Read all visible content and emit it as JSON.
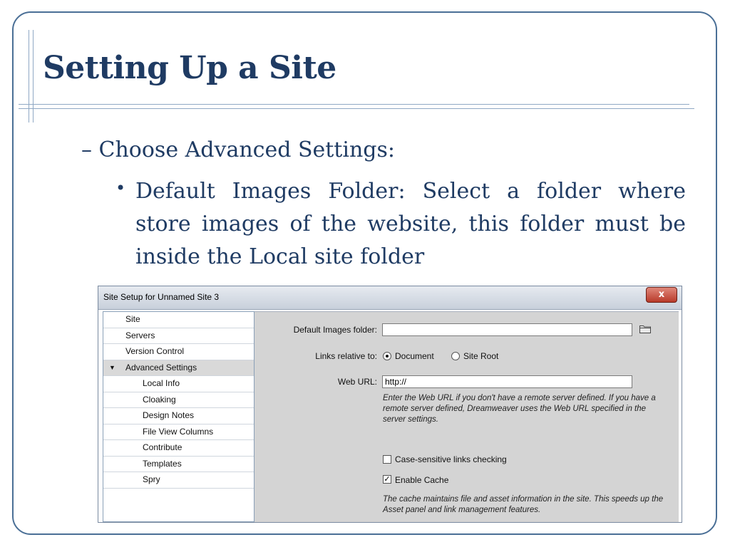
{
  "slide": {
    "title": "Setting Up a Site",
    "level1": "– Choose Advanced Settings:",
    "bullet": "•",
    "level2": "Default Images Folder: Select a folder where store images of the website, this folder must be inside the Local site folder"
  },
  "dialog": {
    "title": "Site Setup for Unnamed Site 3",
    "close_label": "x",
    "nav": [
      {
        "label": "Site"
      },
      {
        "label": "Servers"
      },
      {
        "label": "Version Control"
      },
      {
        "label": "Advanced Settings",
        "expanded": true
      },
      {
        "label": "Local Info"
      },
      {
        "label": "Cloaking"
      },
      {
        "label": "Design Notes"
      },
      {
        "label": "File View Columns"
      },
      {
        "label": "Contribute"
      },
      {
        "label": "Templates"
      },
      {
        "label": "Spry"
      }
    ],
    "fields": {
      "images_folder_label": "Default Images folder:",
      "images_folder_value": "",
      "links_relative_label": "Links relative to:",
      "radio_document": "Document",
      "radio_site_root": "Site Root",
      "links_relative_selected": "Document",
      "web_url_label": "Web URL:",
      "web_url_value": "http://",
      "web_url_hint": "Enter the Web URL if you don't have a remote server defined. If you have a remote server defined, Dreamweaver uses the Web URL specified in the server settings.",
      "case_sensitive_label": "Case-sensitive links checking",
      "case_sensitive_checked": false,
      "enable_cache_label": "Enable Cache",
      "enable_cache_checked": true,
      "cache_hint": "The cache maintains file and asset information in the site. This speeds up the Asset panel and link management features."
    }
  },
  "icons": {
    "close": "close-icon",
    "expand": "triangle-down-icon",
    "folder": "folder-icon",
    "check": "checkmark-icon"
  },
  "colors": {
    "title_text": "#1f3b63",
    "frame_border": "#4a6f96",
    "panel_bg": "#d4d4d4",
    "close_button": "#c4483a"
  }
}
